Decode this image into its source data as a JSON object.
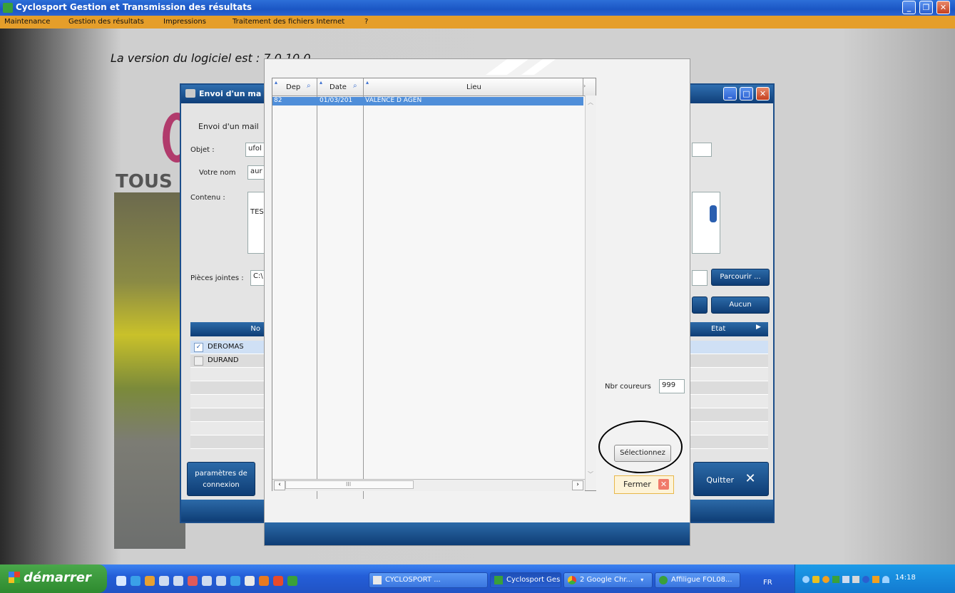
{
  "window": {
    "title": "Cyclosport Gestion et Transmission des résultats"
  },
  "menu": [
    "Maintenance",
    "Gestion des résultats",
    "Impressions",
    "Traitement des fichiers Internet",
    "?"
  ],
  "background": {
    "version_text": "La version  du logiciel est : 7.0.10.0",
    "banner_text": "TOUS"
  },
  "mail_window": {
    "title": "Envoi d'un ma",
    "heading": "Envoi d'un mail",
    "objet_label": "Objet :",
    "objet_value": "ufol",
    "votre_nom_label": "Votre nom",
    "votre_nom_value": "aur",
    "contenu_label": "Contenu :",
    "contenu_value": "TES",
    "pieces_label": "Pièces jointes :",
    "pieces_value": "C:\\",
    "parcourir_label": "Parcourir ...",
    "aucun_label": "Aucun",
    "grid_col_nom": "No",
    "grid_col_etat": "Etat",
    "rows": [
      {
        "name": "DEROMAS",
        "checked": true
      },
      {
        "name": "DURAND",
        "checked": false
      }
    ],
    "params_label_1": "paramètres de",
    "params_label_2": "connexion",
    "quitter_label": "Quitter"
  },
  "select_dialog": {
    "columns": [
      "Dep",
      "Date",
      "Lieu"
    ],
    "rows": [
      {
        "dep": "82",
        "date": "01/03/201",
        "lieu": "VALENCE D AGEN"
      }
    ],
    "scroll_mark": "III",
    "nbr_label": "Nbr coureurs",
    "nbr_value": "999",
    "select_label": "Sélectionnez",
    "fermer_label": "Fermer"
  },
  "taskbar": {
    "start_label": "démarrer",
    "items": [
      "CYCLOSPORT ...",
      "Cyclosport Ges...",
      "2 Google Chr...",
      "Affiligue FOL08..."
    ],
    "lang": "FR",
    "clock": "14:18"
  }
}
